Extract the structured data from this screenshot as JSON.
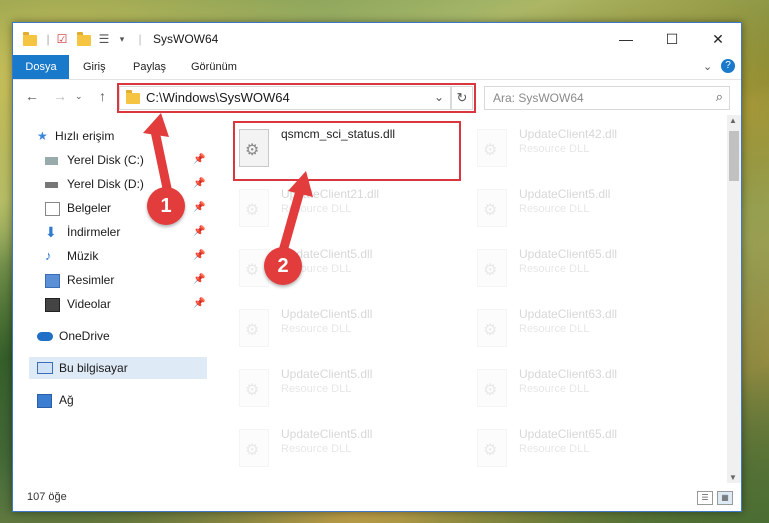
{
  "window": {
    "title": "SysWOW64"
  },
  "ribbon": {
    "tabs": [
      "Dosya",
      "Giriş",
      "Paylaş",
      "Görünüm"
    ]
  },
  "address": {
    "path": "C:\\Windows\\SysWOW64"
  },
  "search": {
    "placeholder": "Ara: SysWOW64"
  },
  "sidebar": {
    "quick_access": "Hızlı erişim",
    "items": [
      "Yerel Disk (C:)",
      "Yerel Disk (D:)",
      "Belgeler",
      "İndirmeler",
      "Müzik",
      "Resimler",
      "Videolar"
    ],
    "onedrive": "OneDrive",
    "this_pc": "Bu bilgisayar",
    "network": "Ağ"
  },
  "files": {
    "selected": {
      "name": "qsmcm_sci_status.dll"
    },
    "left_col": [
      {
        "name": "UpdateClient21.dll",
        "type": "Resource DLL"
      },
      {
        "name": "UpdateClient5.dll",
        "type": "Resource DLL"
      },
      {
        "name": "UpdateClient5.dll",
        "type": "Resource DLL"
      },
      {
        "name": "UpdateClient5.dll",
        "type": "Resource DLL"
      },
      {
        "name": "UpdateClient5.dll",
        "type": "Resource DLL"
      }
    ],
    "right_col": [
      {
        "name": "UpdateClient42.dll",
        "type": "Resource DLL"
      },
      {
        "name": "UpdateClient5.dll",
        "type": "Resource DLL"
      },
      {
        "name": "UpdateClient65.dll",
        "type": "Resource DLL"
      },
      {
        "name": "UpdateClient63.dll",
        "type": "Resource DLL"
      },
      {
        "name": "UpdateClient63.dll",
        "type": "Resource DLL"
      },
      {
        "name": "UpdateClient65.dll",
        "type": "Resource DLL"
      }
    ]
  },
  "status": {
    "count": "107 öğe"
  },
  "callouts": {
    "one": "1",
    "two": "2"
  },
  "colors": {
    "accent": "#1979ca",
    "highlight": "#d9363e"
  },
  "icons": [
    "folder-icon",
    "back-icon",
    "forward-icon",
    "up-icon",
    "refresh-icon",
    "search-icon",
    "dll-file-icon",
    "pin-icon"
  ]
}
